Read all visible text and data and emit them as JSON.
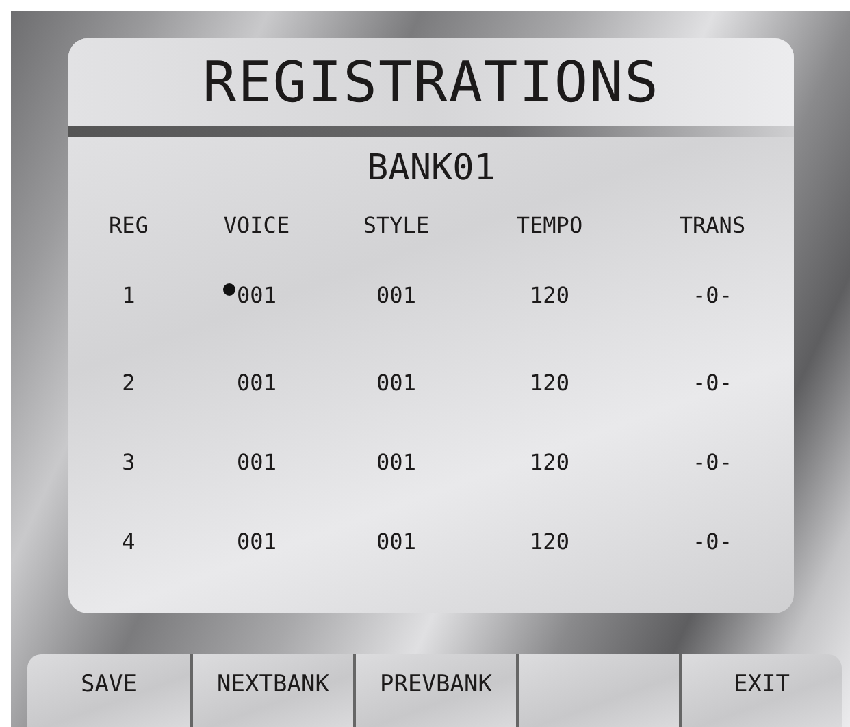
{
  "title": "REGISTRATIONS",
  "bank": "BANK01",
  "columns": [
    "REG",
    "VOICE",
    "STYLE",
    "TEMPO",
    "TRANS"
  ],
  "rows": [
    {
      "reg": "1",
      "voice": "001",
      "style": "001",
      "tempo": "120",
      "trans": "-0-",
      "selected": true
    },
    {
      "reg": "2",
      "voice": "001",
      "style": "001",
      "tempo": "120",
      "trans": "-0-",
      "selected": false
    },
    {
      "reg": "3",
      "voice": "001",
      "style": "001",
      "tempo": "120",
      "trans": "-0-",
      "selected": false
    },
    {
      "reg": "4",
      "voice": "001",
      "style": "001",
      "tempo": "120",
      "trans": "-0-",
      "selected": false
    }
  ],
  "softkeys": [
    {
      "kind": "label",
      "label": "SAVE"
    },
    {
      "kind": "label",
      "label": "NEXTBANK"
    },
    {
      "kind": "label",
      "label": "PREVBANK"
    },
    {
      "kind": "blank"
    },
    {
      "kind": "label",
      "label": "EXIT"
    }
  ]
}
